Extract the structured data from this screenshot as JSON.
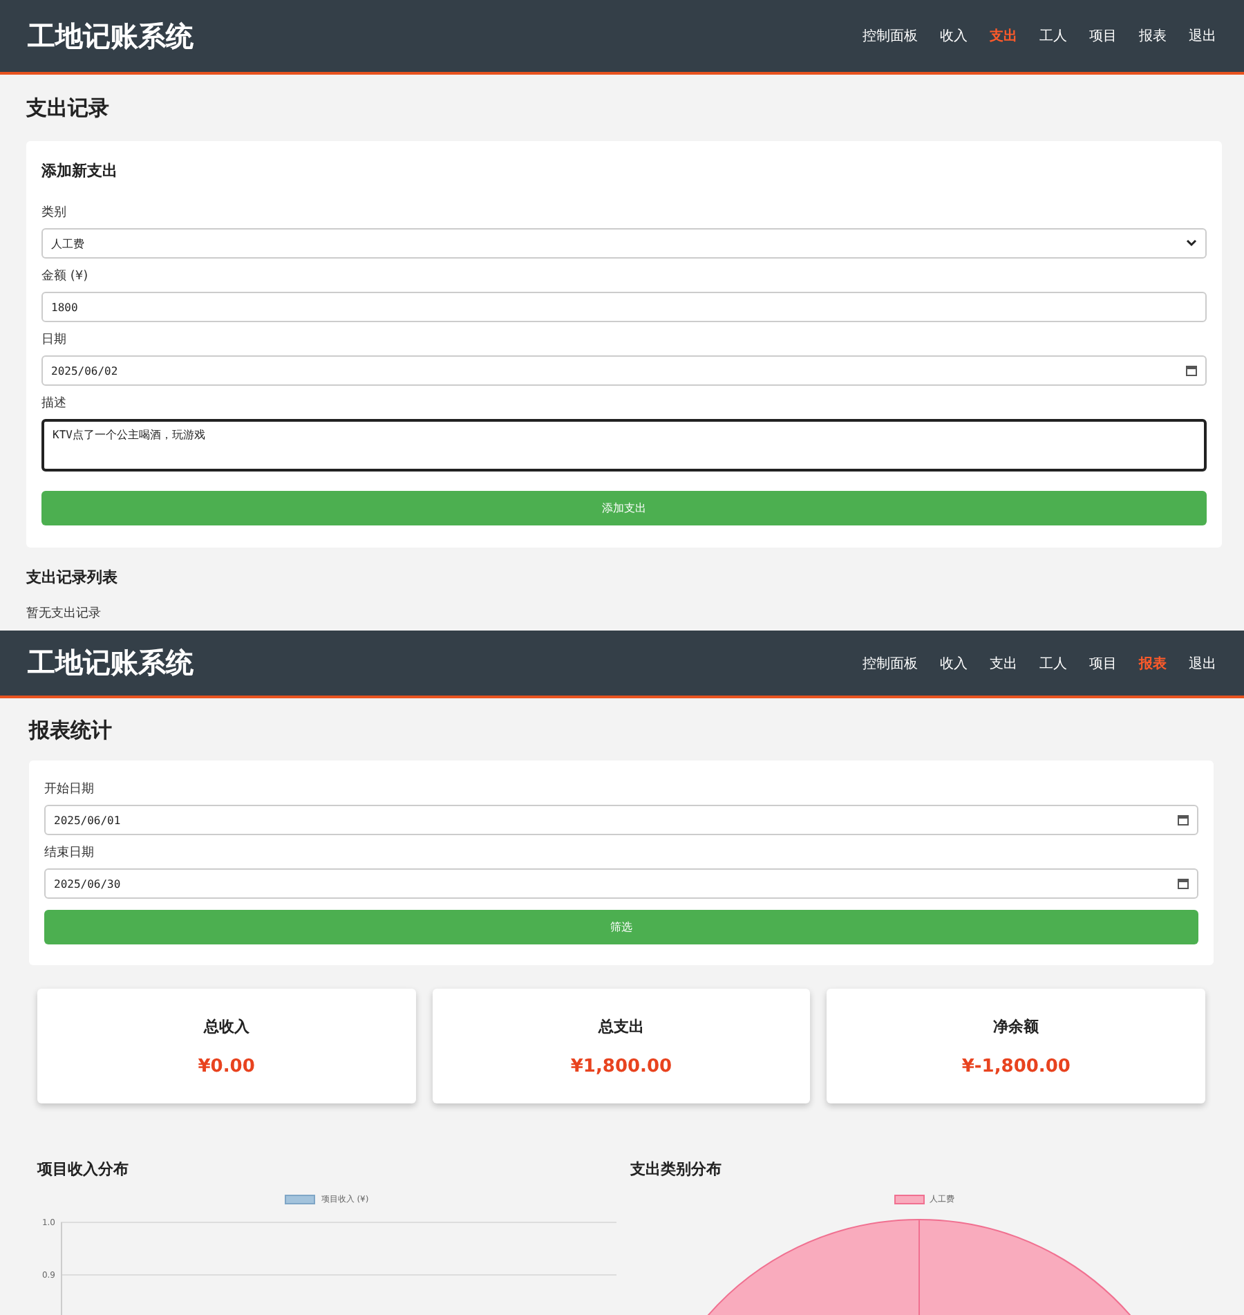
{
  "screens": [
    {
      "app_title": "工地记账系统",
      "nav": [
        {
          "label": "控制面板",
          "selected": false
        },
        {
          "label": "收入",
          "selected": false
        },
        {
          "label": "支出",
          "selected": true
        },
        {
          "label": "工人",
          "selected": false
        },
        {
          "label": "项目",
          "selected": false
        },
        {
          "label": "报表",
          "selected": false
        },
        {
          "label": "退出",
          "selected": false
        }
      ],
      "heading": "支出记录",
      "form": {
        "title": "添加新支出",
        "fields": [
          {
            "kind": "select",
            "label": "类别",
            "value": "人工费",
            "focused": false
          },
          {
            "kind": "text",
            "label": "金额 (¥)",
            "value": "1800",
            "focused": false
          },
          {
            "kind": "date",
            "label": "日期",
            "value": "2025/06/02",
            "focused": false
          },
          {
            "kind": "textarea",
            "label": "描述",
            "value": "KTV点了一个公主喝酒，玩游戏",
            "focused": true
          }
        ],
        "button": "添加支出"
      },
      "list": {
        "title": "支出记录列表",
        "empty_text": "暂无支出记录"
      }
    },
    {
      "app_title": "工地记账系统",
      "nav": [
        {
          "label": "控制面板",
          "selected": false
        },
        {
          "label": "收入",
          "selected": false
        },
        {
          "label": "支出",
          "selected": false
        },
        {
          "label": "工人",
          "selected": false
        },
        {
          "label": "项目",
          "selected": false
        },
        {
          "label": "报表",
          "selected": true
        },
        {
          "label": "退出",
          "selected": false
        }
      ],
      "heading": "报表统计",
      "form": {
        "fields": [
          {
            "kind": "date",
            "label": "开始日期",
            "value": "2025/06/01",
            "focused": false
          },
          {
            "kind": "date",
            "label": "结束日期",
            "value": "2025/06/30",
            "focused": false
          }
        ],
        "button": "筛选"
      },
      "stats": [
        {
          "label": "总收入",
          "value": "¥0.00"
        },
        {
          "label": "总支出",
          "value": "¥1,800.00"
        },
        {
          "label": "净余额",
          "value": "¥-1,800.00"
        }
      ],
      "charts": [
        {
          "title": "项目收入分布",
          "chart_data": {
            "type": "bar",
            "series": [
              {
                "name": "项目收入 (¥)",
                "color": "#a3c3dc"
              }
            ],
            "yticks": [
              0.9,
              {
                "value": 1,
                "label": "1.0"
              }
            ],
            "ylim": [
              0.82,
              1.0
            ]
          }
        },
        {
          "title": "支出类别分布",
          "chart_data": {
            "type": "pie",
            "categories": [
              "人工费"
            ],
            "series": [
              {
                "color": "#f9abbd",
                "values": [
                  100
                ]
              }
            ]
          }
        }
      ]
    }
  ]
}
